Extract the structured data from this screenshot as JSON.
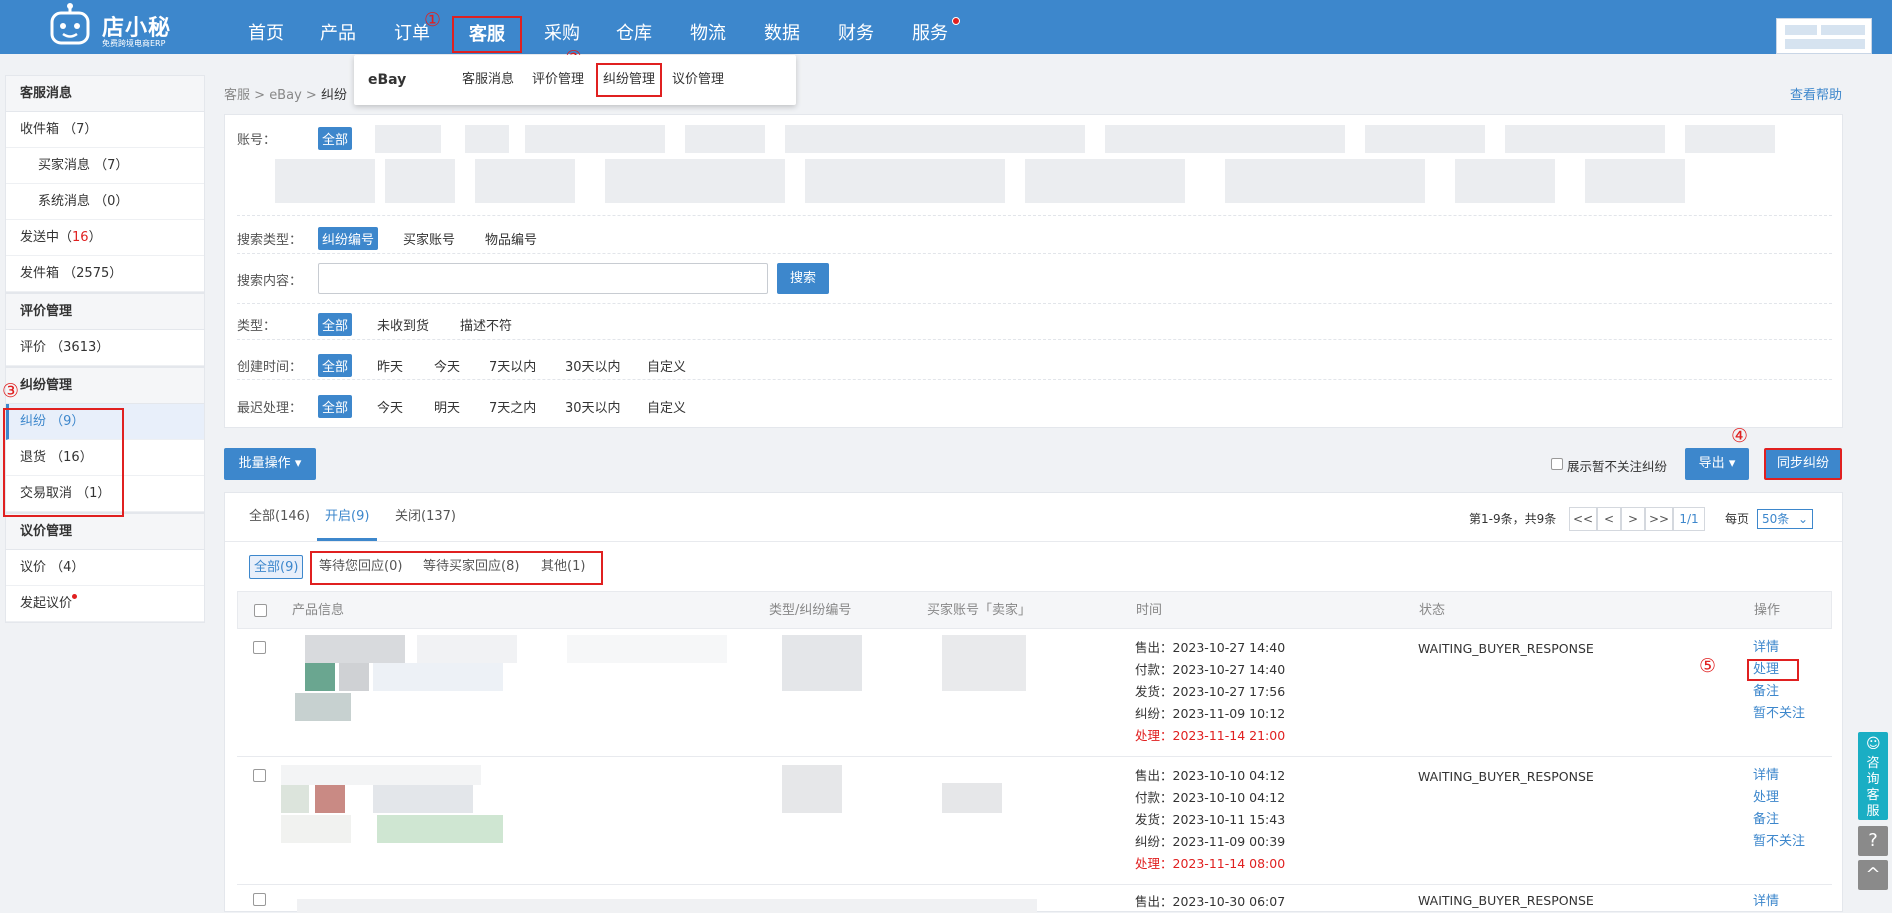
{
  "logo": {
    "brand": "店小秘",
    "slogan": "免费跨境电商ERP"
  },
  "nav": {
    "items": [
      "首页",
      "产品",
      "订单",
      "客服",
      "采购",
      "仓库",
      "物流",
      "数据",
      "财务",
      "服务"
    ],
    "active": "客服"
  },
  "markers": [
    "①",
    "②",
    "③",
    "④",
    "⑤"
  ],
  "dropdown": {
    "platform": "eBay",
    "items": [
      "客服消息",
      "评价管理",
      "纠纷管理",
      "议价管理"
    ],
    "active": "纠纷管理"
  },
  "sidebar": {
    "groups": [
      {
        "title": "客服消息",
        "items": [
          {
            "label": "收件箱",
            "count": "（7）"
          },
          {
            "label": "买家消息",
            "count": "（7）"
          },
          {
            "label": "系统消息",
            "count": "（0）"
          },
          {
            "label": "发送中",
            "count": "16"
          },
          {
            "label": "发件箱",
            "count": "（2575）"
          }
        ]
      },
      {
        "title": "评价管理",
        "items": [
          {
            "label": "评价",
            "count": "（3613）"
          }
        ]
      },
      {
        "title": "纠纷管理",
        "items": [
          {
            "label": "纠纷",
            "count": "（9）"
          },
          {
            "label": "退货",
            "count": "（16）"
          },
          {
            "label": "交易取消",
            "count": "（1）"
          }
        ]
      },
      {
        "title": "议价管理",
        "items": [
          {
            "label": "议价",
            "count": "（4）"
          },
          {
            "label": "发起议价",
            "count": ""
          }
        ]
      }
    ]
  },
  "breadcrumb": {
    "a": "客服",
    "b": "eBay",
    "c": "纠纷"
  },
  "help_link": "查看帮助",
  "filters": {
    "account_label": "账号：",
    "all": "全部",
    "search_type_label": "搜索类型：",
    "search_types": [
      "纠纷编号",
      "买家账号",
      "物品编号"
    ],
    "search_content_label": "搜索内容：",
    "search_value": "",
    "search_button": "搜索",
    "type_label": "类型：",
    "types": [
      "未收到货",
      "描述不符"
    ],
    "create_label": "创建时间：",
    "create_opts": [
      "昨天",
      "今天",
      "7天以内",
      "30天以内",
      "自定义"
    ],
    "deadline_label": "最迟处理：",
    "deadline_opts": [
      "今天",
      "明天",
      "7天之内",
      "30天以内",
      "自定义"
    ]
  },
  "toolbar": {
    "batch": "批量操作",
    "show_ignored": "展示暂不关注纠纷",
    "export": "导出",
    "sync": "同步纠纷"
  },
  "tabs": [
    "全部(146)",
    "开启(9)",
    "关闭(137)"
  ],
  "pager": {
    "info": "第1-9条，共9条",
    "first": "<<",
    "prev": "<",
    "next": ">",
    "last": ">>",
    "page": "1/1",
    "per_label": "每页",
    "per_value": "50条"
  },
  "subtabs": [
    "全部(9)",
    "等待您回应(0)",
    "等待买家回应(8)",
    "其他(1)"
  ],
  "table": {
    "headers": [
      "产品信息",
      "类型/纠纷编号",
      "买家账号「卖家」",
      "时间",
      "状态",
      "操作"
    ],
    "rows": [
      {
        "times": [
          "售出：2023-10-27 14:40",
          "付款：2023-10-27 14:40",
          "发货：2023-10-27 17:56",
          "纠纷：2023-11-09 10:12",
          "处理：2023-11-14 21:00"
        ],
        "status": "WAITING_BUYER_RESPONSE"
      },
      {
        "times": [
          "售出：2023-10-10 04:12",
          "付款：2023-10-10 04:12",
          "发货：2023-10-11 15:43",
          "纠纷：2023-11-09 00:39",
          "处理：2023-11-14 08:00"
        ],
        "status": "WAITING_BUYER_RESPONSE"
      },
      {
        "times": [
          "售出：2023-10-30 06:07"
        ],
        "status": "WAITING_BUYER_RESPONSE"
      }
    ],
    "actions": [
      "详情",
      "处理",
      "备注",
      "暂不关注"
    ]
  },
  "float": {
    "consult": "咨询客服",
    "help": "?",
    "top": "^"
  }
}
